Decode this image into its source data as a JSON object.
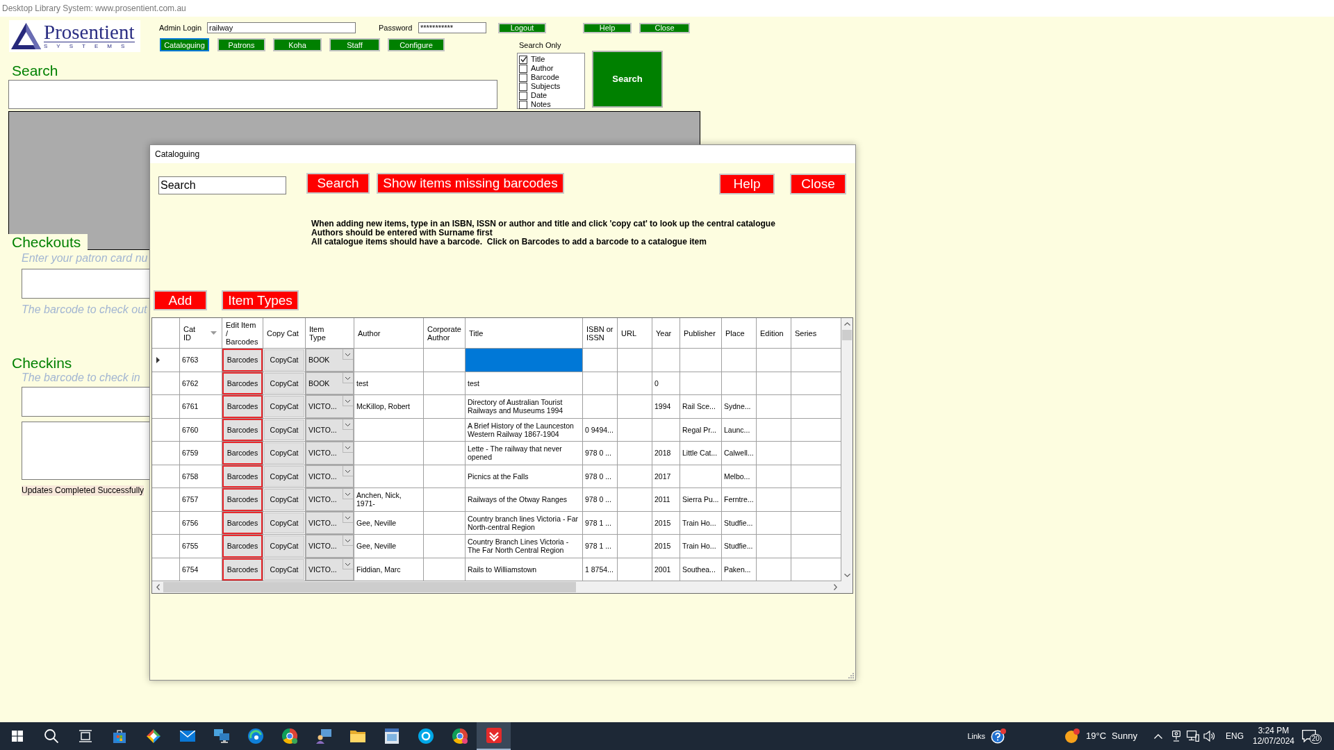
{
  "window": {
    "title": "Desktop Library System: www.prosentient.com.au"
  },
  "main": {
    "logo": {
      "name": "Prosentient",
      "tagline": "SYSTEMS"
    },
    "login": {
      "label": "Admin Login",
      "value": "railway"
    },
    "password": {
      "label": "Password",
      "value": "***********"
    },
    "session_buttons": [
      {
        "label": "Logout"
      },
      {
        "label": "Help"
      },
      {
        "label": "Close"
      }
    ],
    "nav": [
      {
        "label": "Cataloguing",
        "selected": true
      },
      {
        "label": "Patrons",
        "selected": false
      },
      {
        "label": "Koha",
        "selected": false
      },
      {
        "label": "Staff",
        "selected": false
      },
      {
        "label": "Configure",
        "selected": false
      }
    ],
    "search": {
      "heading": "Search",
      "filter_title": "Search Only",
      "filters": [
        {
          "label": "Title",
          "checked": true
        },
        {
          "label": "Author",
          "checked": false
        },
        {
          "label": "Barcode",
          "checked": false
        },
        {
          "label": "Subjects",
          "checked": false
        },
        {
          "label": "Date",
          "checked": false
        },
        {
          "label": "Notes",
          "checked": false
        }
      ],
      "button": "Search"
    },
    "checkouts": {
      "heading": "Checkouts",
      "patron_hint": "Enter your patron card nu",
      "barcode_hint": "The barcode to check out"
    },
    "checkins": {
      "heading": "Checkins",
      "barcode_hint": "The barcode to check in"
    },
    "status": "Updates Completed Successfully"
  },
  "dialog": {
    "title": "Cataloguing",
    "search": {
      "value": "Search"
    },
    "toolbar": [
      {
        "label": "Search"
      },
      {
        "label": "Show items missing barcodes"
      }
    ],
    "window_buttons": [
      {
        "label": "Help"
      },
      {
        "label": "Close"
      }
    ],
    "instructions": [
      "When adding new items, type in an ISBN, ISSN or author and title and click 'copy cat' to look up the central catalogue",
      "Authors should be entered with Surname first",
      "All catalogue items should have a barcode.  Click on Barcodes to add a barcode to a catalogue item"
    ],
    "actions": [
      {
        "label": "Add"
      },
      {
        "label": "Item Types"
      }
    ],
    "table": {
      "columns": [
        {
          "label": "Cat ID",
          "kind": "text",
          "sorted": true
        },
        {
          "label": "Edit Item / Barcodes",
          "kind": "editbutton",
          "sorted": false
        },
        {
          "label": "Copy Cat",
          "kind": "button",
          "sorted": false
        },
        {
          "label": "Item Type",
          "kind": "combo",
          "sorted": false
        },
        {
          "label": "Author",
          "kind": "text",
          "sorted": false
        },
        {
          "label": "Corporate Author",
          "kind": "text",
          "sorted": false
        },
        {
          "label": "Title",
          "kind": "title",
          "sorted": false
        },
        {
          "label": "ISBN or ISSN",
          "kind": "text",
          "sorted": false
        },
        {
          "label": "URL",
          "kind": "text",
          "sorted": false
        },
        {
          "label": "Year",
          "kind": "text",
          "sorted": false
        },
        {
          "label": "Publisher",
          "kind": "text",
          "sorted": false
        },
        {
          "label": "Place",
          "kind": "text",
          "sorted": false
        },
        {
          "label": "Edition",
          "kind": "text",
          "sorted": false
        },
        {
          "label": "Series",
          "kind": "text",
          "sorted": false
        }
      ],
      "rows": [
        {
          "selected": true,
          "cat_id": "6763",
          "edit": "Barcodes",
          "copy_cat": "CopyCat",
          "item_type": "BOOK"
        },
        {
          "selected": false,
          "cat_id": "6762",
          "edit": "Barcodes",
          "copy_cat": "CopyCat",
          "item_type": "BOOK",
          "author": "test",
          "title": "test",
          "year": "0"
        },
        {
          "selected": false,
          "cat_id": "6761",
          "edit": "Barcodes",
          "copy_cat": "CopyCat",
          "item_type": "VICTO...",
          "author": "McKillop, Robert",
          "title": "Directory of Australian Tourist Railways and Museums 1994",
          "year": "1994",
          "publisher": "Rail Sce...",
          "place": "Sydne..."
        },
        {
          "selected": false,
          "cat_id": "6760",
          "edit": "Barcodes",
          "copy_cat": "CopyCat",
          "item_type": "VICTO...",
          "title": "A Brief History of the Launceston Western Railway 1867-1904",
          "isbn_issn": "0 9494...",
          "publisher": "Regal Pr...",
          "place": "Launc..."
        },
        {
          "selected": false,
          "cat_id": "6759",
          "edit": "Barcodes",
          "copy_cat": "CopyCat",
          "item_type": "VICTO...",
          "title": "Lette - The railway that never opened",
          "isbn_issn": "978 0 ...",
          "year": "2018",
          "publisher": "Little Cat...",
          "place": "Calwell..."
        },
        {
          "selected": false,
          "cat_id": "6758",
          "edit": "Barcodes",
          "copy_cat": "CopyCat",
          "item_type": "VICTO...",
          "title": "Picnics at the Falls",
          "isbn_issn": "978 0 ...",
          "year": "2017",
          "place": "Melbo..."
        },
        {
          "selected": false,
          "cat_id": "6757",
          "edit": "Barcodes",
          "copy_cat": "CopyCat",
          "item_type": "VICTO...",
          "author": "Anchen, Nick, 1971-",
          "title": "Railways of the Otway Ranges",
          "isbn_issn": "978 0 ...",
          "year": "2011",
          "publisher": "Sierra Pu...",
          "place": "Ferntre..."
        },
        {
          "selected": false,
          "cat_id": "6756",
          "edit": "Barcodes",
          "copy_cat": "CopyCat",
          "item_type": "VICTO...",
          "author": "Gee, Neville",
          "title": "Country branch lines Victoria - Far North-central Region",
          "isbn_issn": "978 1 ...",
          "year": "2015",
          "publisher": "Train Ho...",
          "place": "Studfie..."
        },
        {
          "selected": false,
          "cat_id": "6755",
          "edit": "Barcodes",
          "copy_cat": "CopyCat",
          "item_type": "VICTO...",
          "author": "Gee, Neville",
          "title": "Country Branch Lines Victoria - The Far North Central Region",
          "isbn_issn": "978 1 ...",
          "year": "2015",
          "publisher": "Train Ho...",
          "place": "Studfie..."
        },
        {
          "selected": false,
          "cat_id": "6754",
          "edit": "Barcodes",
          "copy_cat": "CopyCat",
          "item_type": "VICTO...",
          "author": "Fiddian, Marc",
          "title": "Rails to Williamstown",
          "isbn_issn": "1 8754...",
          "year": "2001",
          "publisher": "Southea...",
          "place": "Paken..."
        }
      ]
    }
  },
  "taskbar": {
    "apps": [
      {
        "selected": false
      },
      {
        "selected": false
      },
      {
        "selected": false
      },
      {
        "selected": false
      },
      {
        "selected": false
      },
      {
        "selected": false
      },
      {
        "selected": false
      },
      {
        "selected": false
      },
      {
        "selected": false
      },
      {
        "selected": false
      },
      {
        "selected": false
      },
      {
        "selected": false
      },
      {
        "selected": false
      },
      {
        "selected": false
      },
      {
        "selected": true
      }
    ],
    "tray": {
      "links": "Links",
      "temperature": "19°C",
      "condition": "Sunny",
      "language": "ENG",
      "time": "3:24 PM",
      "date": "12/07/2024",
      "notifications": "20"
    }
  }
}
